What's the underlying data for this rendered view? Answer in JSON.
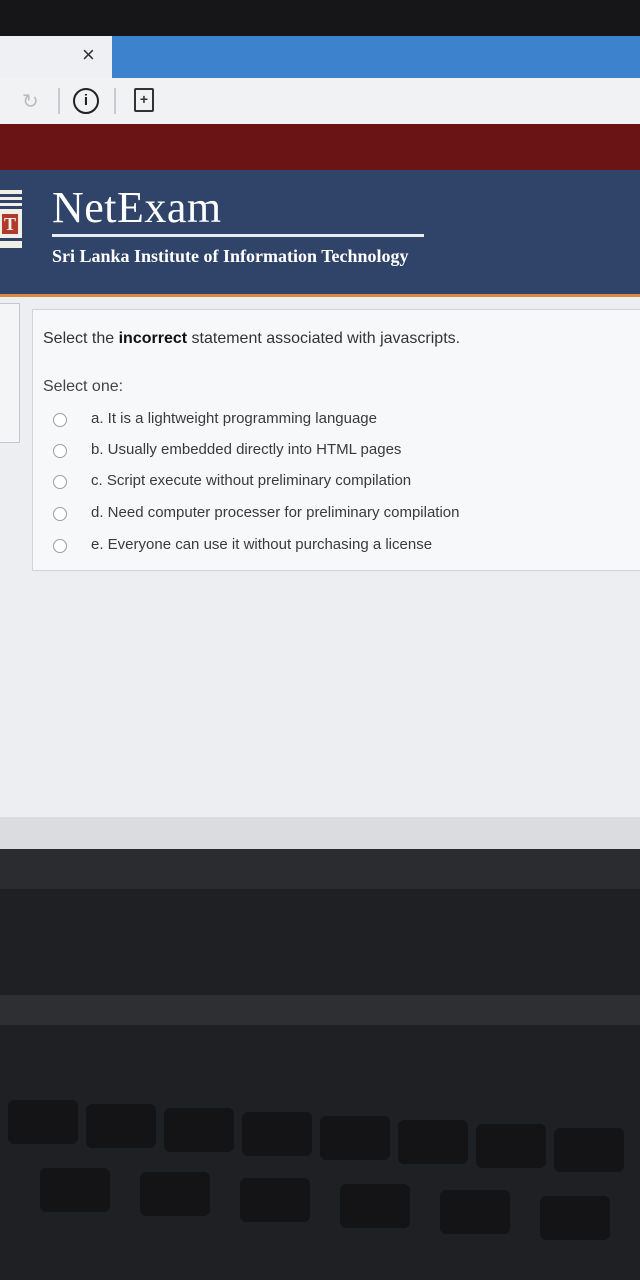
{
  "browser": {
    "close_glyph": "×",
    "info_glyph": "i",
    "page_glyph": "+",
    "refresh_glyph": "↻"
  },
  "header": {
    "brand": "NetExam",
    "subtitle": "Sri Lanka Institute of Information Technology",
    "logo_letter": "T"
  },
  "question": {
    "prefix": "Select the ",
    "emphasis": "incorrect",
    "suffix": " statement associated with javascripts.",
    "prompt": "Select one:",
    "options": [
      "a. It is a lightweight programming language",
      "b. Usually embedded directly into HTML pages",
      "c. Script execute without preliminary compilation",
      "d. Need computer processer for preliminary compilation",
      "e. Everyone can use it without purchasing a license"
    ]
  },
  "colors": {
    "banner": "#2f4468",
    "accent_rule": "#d98a3c",
    "tab_blue": "#3d82cc",
    "red_band": "#6a1416"
  }
}
